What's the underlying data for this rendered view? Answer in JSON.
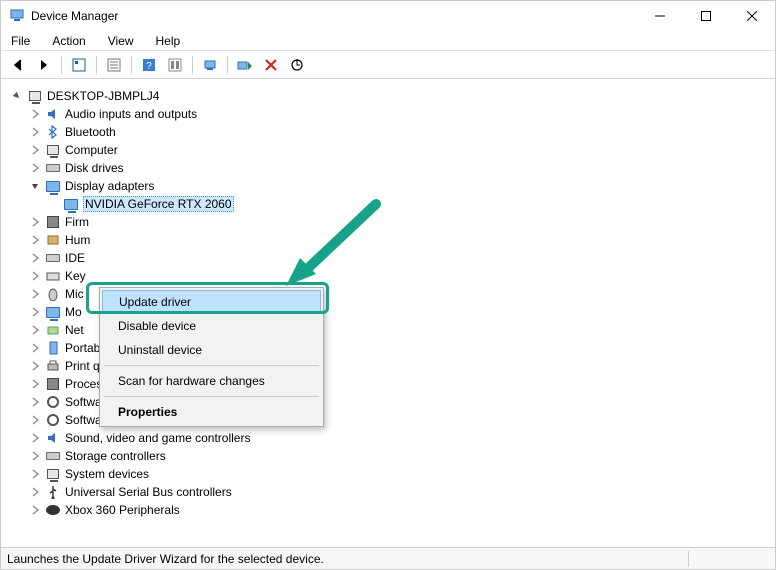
{
  "window": {
    "title": "Device Manager"
  },
  "menu": {
    "file": "File",
    "action": "Action",
    "view": "View",
    "help": "Help"
  },
  "tree": {
    "root": "DESKTOP-JBMPLJ4",
    "nodes": [
      {
        "label": "Audio inputs and outputs",
        "icon": "audio"
      },
      {
        "label": "Bluetooth",
        "icon": "bluetooth"
      },
      {
        "label": "Computer",
        "icon": "pc"
      },
      {
        "label": "Disk drives",
        "icon": "drive"
      },
      {
        "label": "Display adapters",
        "icon": "monitor",
        "expanded": true,
        "children": [
          {
            "label": "NVIDIA GeForce RTX 2060",
            "icon": "monitor",
            "selected": true
          }
        ]
      },
      {
        "label": "Firmware",
        "icon": "chip",
        "trunc": "Firm"
      },
      {
        "label": "Human Interface Devices",
        "icon": "hid",
        "trunc": "Hum"
      },
      {
        "label": "IDE ATA/ATAPI controllers",
        "icon": "drive",
        "trunc": "IDE"
      },
      {
        "label": "Keyboards",
        "icon": "keyboard",
        "trunc": "Key"
      },
      {
        "label": "Mice and other pointing devices",
        "icon": "mouse",
        "trunc": "Mic"
      },
      {
        "label": "Monitors",
        "icon": "monitor",
        "trunc": "Mo"
      },
      {
        "label": "Network adapters",
        "icon": "net",
        "trunc": "Net"
      },
      {
        "label": "Portable Devices",
        "icon": "portable"
      },
      {
        "label": "Print queues",
        "icon": "printer"
      },
      {
        "label": "Processors",
        "icon": "chip"
      },
      {
        "label": "Software components",
        "icon": "gear"
      },
      {
        "label": "Software devices",
        "icon": "gear"
      },
      {
        "label": "Sound, video and game controllers",
        "icon": "audio"
      },
      {
        "label": "Storage controllers",
        "icon": "drive"
      },
      {
        "label": "System devices",
        "icon": "pc"
      },
      {
        "label": "Universal Serial Bus controllers",
        "icon": "usb"
      },
      {
        "label": "Xbox 360 Peripherals",
        "icon": "gamepad"
      }
    ]
  },
  "context_menu": {
    "items": [
      {
        "label": "Update driver",
        "highlight": true
      },
      {
        "label": "Disable device"
      },
      {
        "label": "Uninstall device"
      },
      {
        "sep": true
      },
      {
        "label": "Scan for hardware changes"
      },
      {
        "sep": true
      },
      {
        "label": "Properties",
        "bold": true
      }
    ]
  },
  "statusbar": {
    "text": "Launches the Update Driver Wizard for the selected device."
  }
}
